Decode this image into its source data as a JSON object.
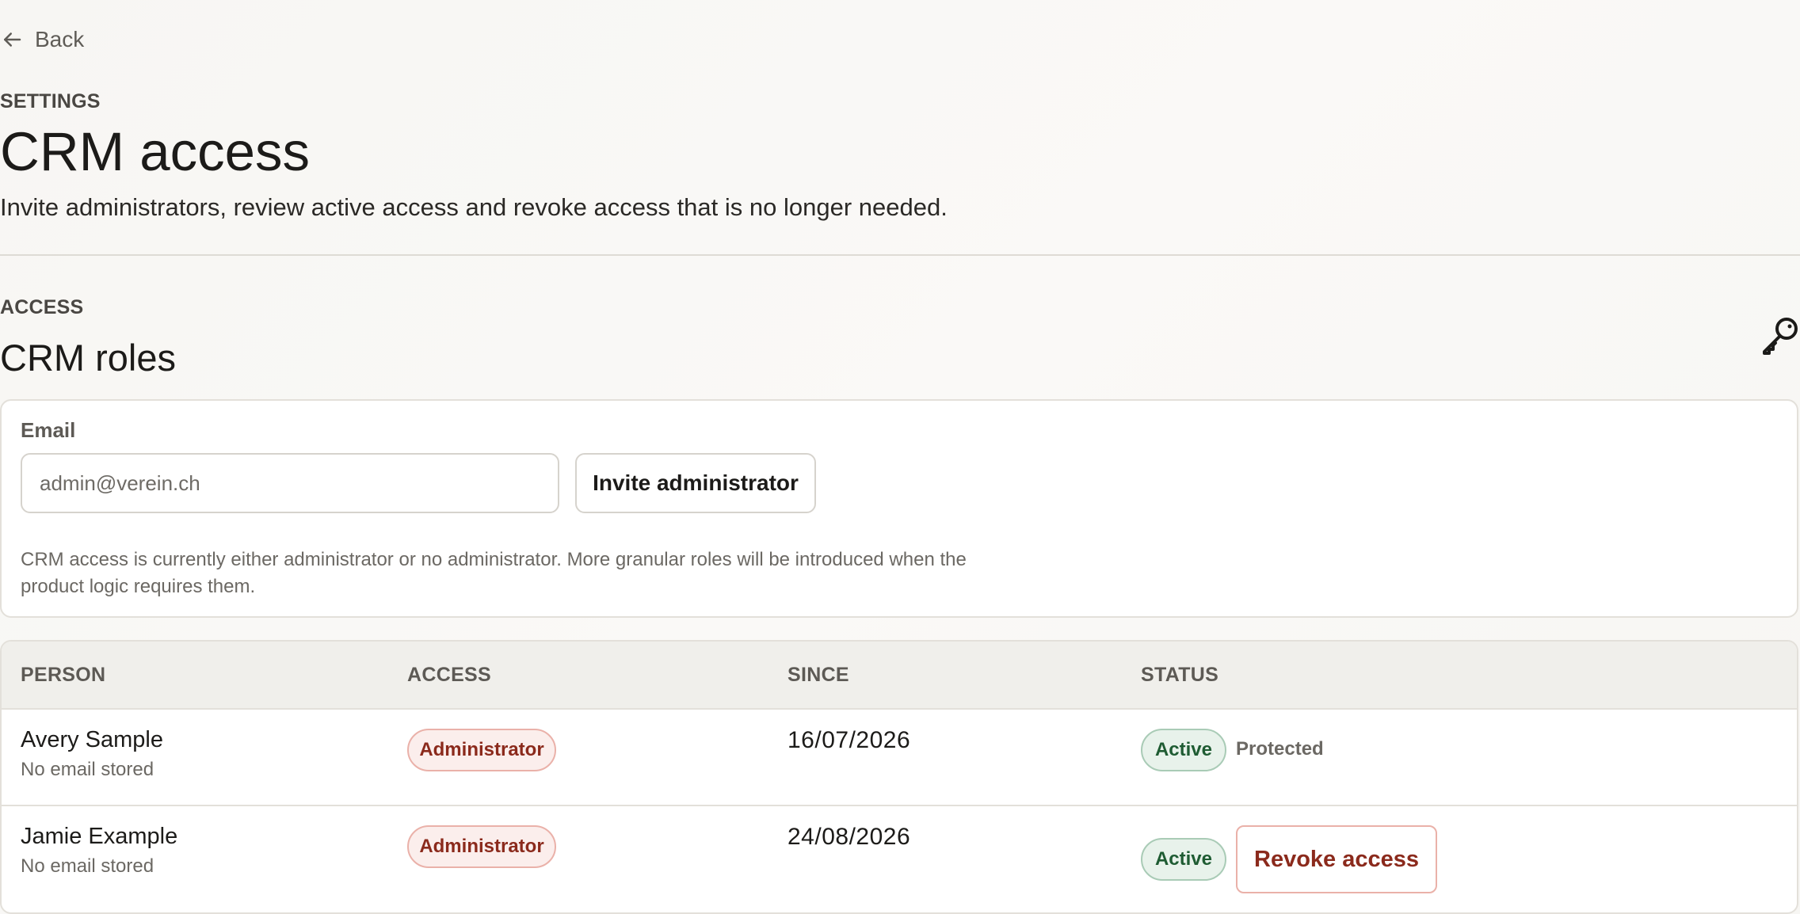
{
  "nav": {
    "back_label": "Back"
  },
  "header": {
    "eyebrow": "SETTINGS",
    "title": "CRM access",
    "subtitle": "Invite administrators, review active access and revoke access that is no longer needed."
  },
  "section": {
    "eyebrow": "ACCESS",
    "title": "CRM roles",
    "icon": "key-icon"
  },
  "invite": {
    "email_label": "Email",
    "email_placeholder": "admin@verein.ch",
    "email_value": "",
    "invite_button": "Invite administrator",
    "hint": "CRM access is currently either administrator or no administrator. More granular roles will be introduced when the product logic requires them."
  },
  "table": {
    "columns": [
      "PERSON",
      "ACCESS",
      "SINCE",
      "STATUS"
    ],
    "rows": [
      {
        "name": "Avery Sample",
        "email": "No email stored",
        "role": "Administrator",
        "since": "16/07/2026",
        "status": "Active",
        "note": "Protected"
      },
      {
        "name": "Jamie Example",
        "email": "No email stored",
        "role": "Administrator",
        "since": "24/08/2026",
        "status": "Active",
        "action": "Revoke access"
      }
    ]
  },
  "colors": {
    "background": "#f8f7f4",
    "text": "#1c1b19",
    "muted": "#6b6863",
    "role_badge_text": "#8b2a1c",
    "role_badge_bg": "#fbeeec",
    "status_badge_text": "#1f5c33",
    "status_badge_bg": "#e8f2eb",
    "revoke_text": "#8b2a1c"
  }
}
